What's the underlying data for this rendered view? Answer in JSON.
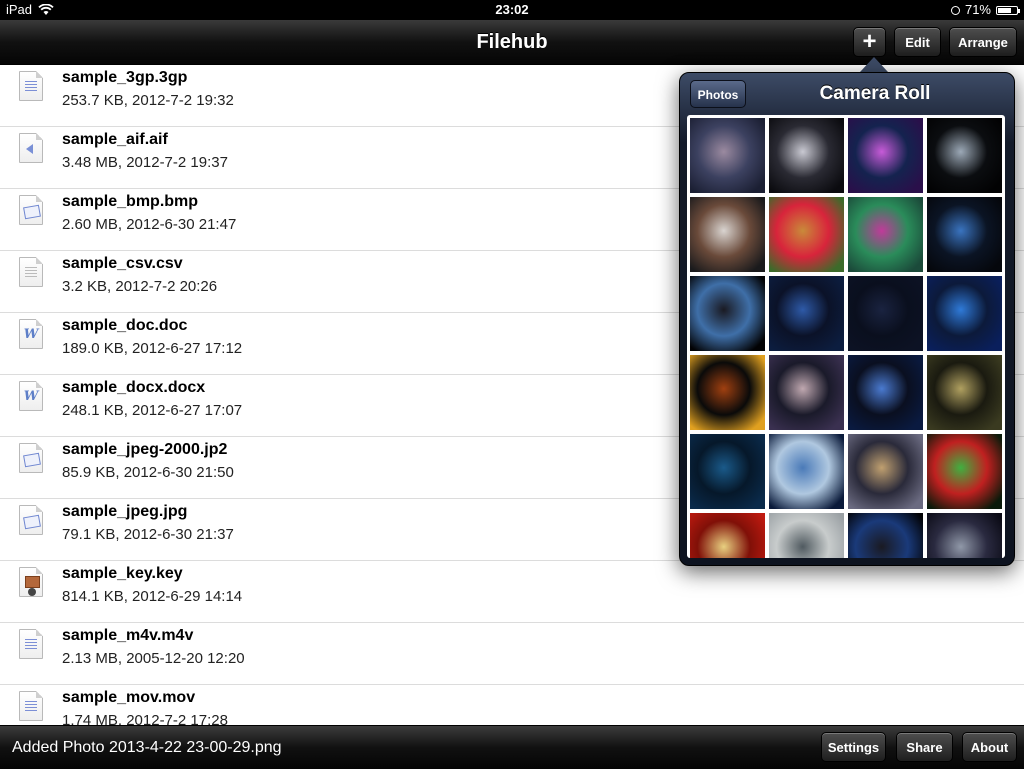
{
  "status_bar": {
    "device": "iPad",
    "time": "23:02",
    "battery": "71%",
    "battery_level": 0.71
  },
  "nav_bar": {
    "title": "Filehub",
    "add_label": "+",
    "edit_label": "Edit",
    "arrange_label": "Arrange"
  },
  "files": [
    {
      "name": "sample_3gp.3gp",
      "meta": "253.7 KB, 2012-7-2 19:32",
      "icon": "video-file-icon"
    },
    {
      "name": "sample_aif.aif",
      "meta": "3.48 MB, 2012-7-2 19:37",
      "icon": "audio-file-icon"
    },
    {
      "name": "sample_bmp.bmp",
      "meta": "2.60 MB, 2012-6-30 21:47",
      "icon": "image-file-icon"
    },
    {
      "name": "sample_csv.csv",
      "meta": "3.2 KB, 2012-7-2 20:26",
      "icon": "text-file-icon"
    },
    {
      "name": "sample_doc.doc",
      "meta": "189.0 KB, 2012-6-27 17:12",
      "icon": "word-file-icon"
    },
    {
      "name": "sample_docx.docx",
      "meta": "248.1 KB, 2012-6-27 17:07",
      "icon": "word-file-icon"
    },
    {
      "name": "sample_jpeg-2000.jp2",
      "meta": "85.9 KB, 2012-6-30 21:50",
      "icon": "image-file-icon"
    },
    {
      "name": "sample_jpeg.jpg",
      "meta": "79.1 KB, 2012-6-30 21:37",
      "icon": "image-file-icon"
    },
    {
      "name": "sample_key.key",
      "meta": "814.1 KB, 2012-6-29 14:14",
      "icon": "keynote-file-icon"
    },
    {
      "name": "sample_m4v.m4v",
      "meta": "2.13 MB, 2005-12-20 12:20",
      "icon": "video-file-icon"
    },
    {
      "name": "sample_mov.mov",
      "meta": "1.74 MB, 2012-7-2 17:28",
      "icon": "video-file-icon"
    }
  ],
  "popover": {
    "back_label": "Photos",
    "title": "Camera Roll",
    "thumbnails": [
      {
        "name": "galaxy-spiral",
        "colors": [
          "#1b1f33",
          "#9b8aa0",
          "#3c4160"
        ]
      },
      {
        "name": "galaxy-edge",
        "colors": [
          "#0b0b0f",
          "#c9c9d2",
          "#2a2a33"
        ]
      },
      {
        "name": "nebula-purple",
        "colors": [
          "#2a0f4a",
          "#c75bd8",
          "#14234f"
        ]
      },
      {
        "name": "moon-crescent",
        "colors": [
          "#020203",
          "#9ca9b7",
          "#0b0d10"
        ]
      },
      {
        "name": "saturn-rings",
        "colors": [
          "#1a1a1c",
          "#d9d4d0",
          "#6a4a3a"
        ]
      },
      {
        "name": "butterfly",
        "colors": [
          "#3c6b2a",
          "#c98a3a",
          "#d8243b"
        ]
      },
      {
        "name": "apple-nebula",
        "colors": [
          "#1b4a3a",
          "#c03a9a",
          "#2a8c5a"
        ]
      },
      {
        "name": "earth",
        "colors": [
          "#05070c",
          "#3a74c0",
          "#0b1424"
        ]
      },
      {
        "name": "moon-earthrise",
        "colors": [
          "#020204",
          "#1a1a22",
          "#3f6fa8"
        ]
      },
      {
        "name": "city-skyline",
        "colors": [
          "#0c1d3f",
          "#2e5aa8",
          "#0b1228"
        ]
      },
      {
        "name": "starfield",
        "colors": [
          "#0c1224",
          "#1a2340",
          "#0a0f1e"
        ]
      },
      {
        "name": "blue-wave",
        "colors": [
          "#0a1f5c",
          "#2f7ad8",
          "#0c1a3a"
        ]
      },
      {
        "name": "sun-planet",
        "colors": [
          "#e0a020",
          "#a04010",
          "#0a0a0a"
        ]
      },
      {
        "name": "galaxy-dust",
        "colors": [
          "#3a3050",
          "#c0a8b0",
          "#1a1a2a"
        ]
      },
      {
        "name": "burj-al-arab",
        "colors": [
          "#0a1a40",
          "#4a7ad0",
          "#0a0f20"
        ]
      },
      {
        "name": "tower-night",
        "colors": [
          "#3a3a20",
          "#b0a060",
          "#1a1a10"
        ]
      },
      {
        "name": "blue-particles",
        "colors": [
          "#0a2a4a",
          "#1a5a8a",
          "#06182a"
        ]
      },
      {
        "name": "milky-way",
        "colors": [
          "#0a1a3a",
          "#4a7ab8",
          "#b0c8e0"
        ]
      },
      {
        "name": "highway-lights",
        "colors": [
          "#6a6a80",
          "#c0a070",
          "#2a2a3a"
        ]
      },
      {
        "name": "green-frog",
        "colors": [
          "#0a1a0a",
          "#40b040",
          "#c02020"
        ]
      },
      {
        "name": "red-bird",
        "colors": [
          "#c01a10",
          "#e8d080",
          "#801008"
        ]
      },
      {
        "name": "rain-window",
        "colors": [
          "#9aa0a4",
          "#505a60",
          "#c8cccc"
        ]
      },
      {
        "name": "moon-space",
        "colors": [
          "#020204",
          "#1a1a22",
          "#1a3a7a"
        ]
      },
      {
        "name": "robot-figure",
        "colors": [
          "#0a0a14",
          "#9098a8",
          "#2a2a40"
        ]
      }
    ]
  },
  "toolbar": {
    "status_text": "Added Photo 2013-4-22 23-00-29.png",
    "settings_label": "Settings",
    "share_label": "Share",
    "about_label": "About"
  }
}
